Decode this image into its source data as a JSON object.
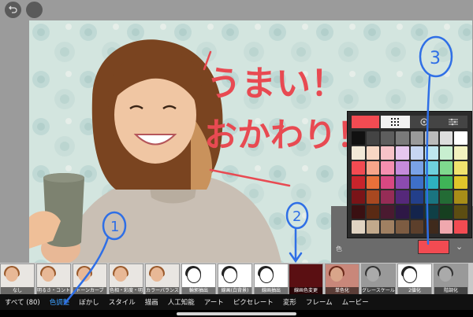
{
  "toolbar": {
    "undo_icon": "undo-arrow-icon",
    "secondary_button": "circle-button"
  },
  "canvas": {
    "handwritten_line1": "うまい！",
    "handwritten_line2": "おかわり！",
    "ink_color": "#e84a52"
  },
  "annotations": {
    "marker1": "1",
    "marker2": "2",
    "marker3": "3",
    "ink_color": "#2f6fe6"
  },
  "color_panel": {
    "label": "色",
    "current_color": "#f24b52",
    "tab_icons": [
      "grid-icon",
      "target-icon",
      "sliders-icon"
    ],
    "swatches": [
      "#111111",
      "#444444",
      "#5e5e5e",
      "#7a7a7a",
      "#9a9a9a",
      "#bbbbbb",
      "#dddddd",
      "#ffffff",
      "#f2e9d8",
      "#f7d7c4",
      "#f7c2c8",
      "#e7c7ef",
      "#c7d6f2",
      "#bfe6ef",
      "#c8efd0",
      "#f2f2bf",
      "#f24b52",
      "#f7a58a",
      "#f58fb0",
      "#c58bdb",
      "#7aa2e6",
      "#6fd0dc",
      "#7fd98e",
      "#f0e26e",
      "#c8242b",
      "#e8703a",
      "#d84882",
      "#8c4bb0",
      "#3e6fc8",
      "#2eb0bf",
      "#3fb457",
      "#e0c52a",
      "#7a1418",
      "#a84820",
      "#962c56",
      "#55287a",
      "#233f8a",
      "#1a7480",
      "#236b35",
      "#a88d18",
      "#3a1012",
      "#5a2a14",
      "#4a1a30",
      "#2e1846",
      "#14244c",
      "#0f3f46",
      "#163f20",
      "#5c4d12",
      "#e0d3c2",
      "#c2a98c",
      "#a08062",
      "#7d5c42",
      "#5c3f2b",
      "#3f2a1c",
      "#f0a8ae",
      "#f24b52"
    ]
  },
  "filters": [
    {
      "label": "なし"
    },
    {
      "label": "明るさ・コントラスト"
    },
    {
      "label": "トーンカーブ"
    },
    {
      "label": "色相・彩度・明度"
    },
    {
      "label": "カラーバランス"
    },
    {
      "label": "輪郭抽出"
    },
    {
      "label": "線画(白背景)"
    },
    {
      "label": "線画抽出"
    },
    {
      "label": "線画色変更"
    },
    {
      "label": "単色化"
    },
    {
      "label": "グレースケール"
    },
    {
      "label": "2値化"
    },
    {
      "label": "階調化"
    }
  ],
  "tabs": [
    {
      "label": "すべて (80)"
    },
    {
      "label": "色調整"
    },
    {
      "label": "ぼかし"
    },
    {
      "label": "スタイル"
    },
    {
      "label": "描画"
    },
    {
      "label": "人工知能"
    },
    {
      "label": "アート"
    },
    {
      "label": "ピクセレート"
    },
    {
      "label": "変形"
    },
    {
      "label": "フレーム"
    },
    {
      "label": "ムービー"
    }
  ],
  "active_tab": 1
}
